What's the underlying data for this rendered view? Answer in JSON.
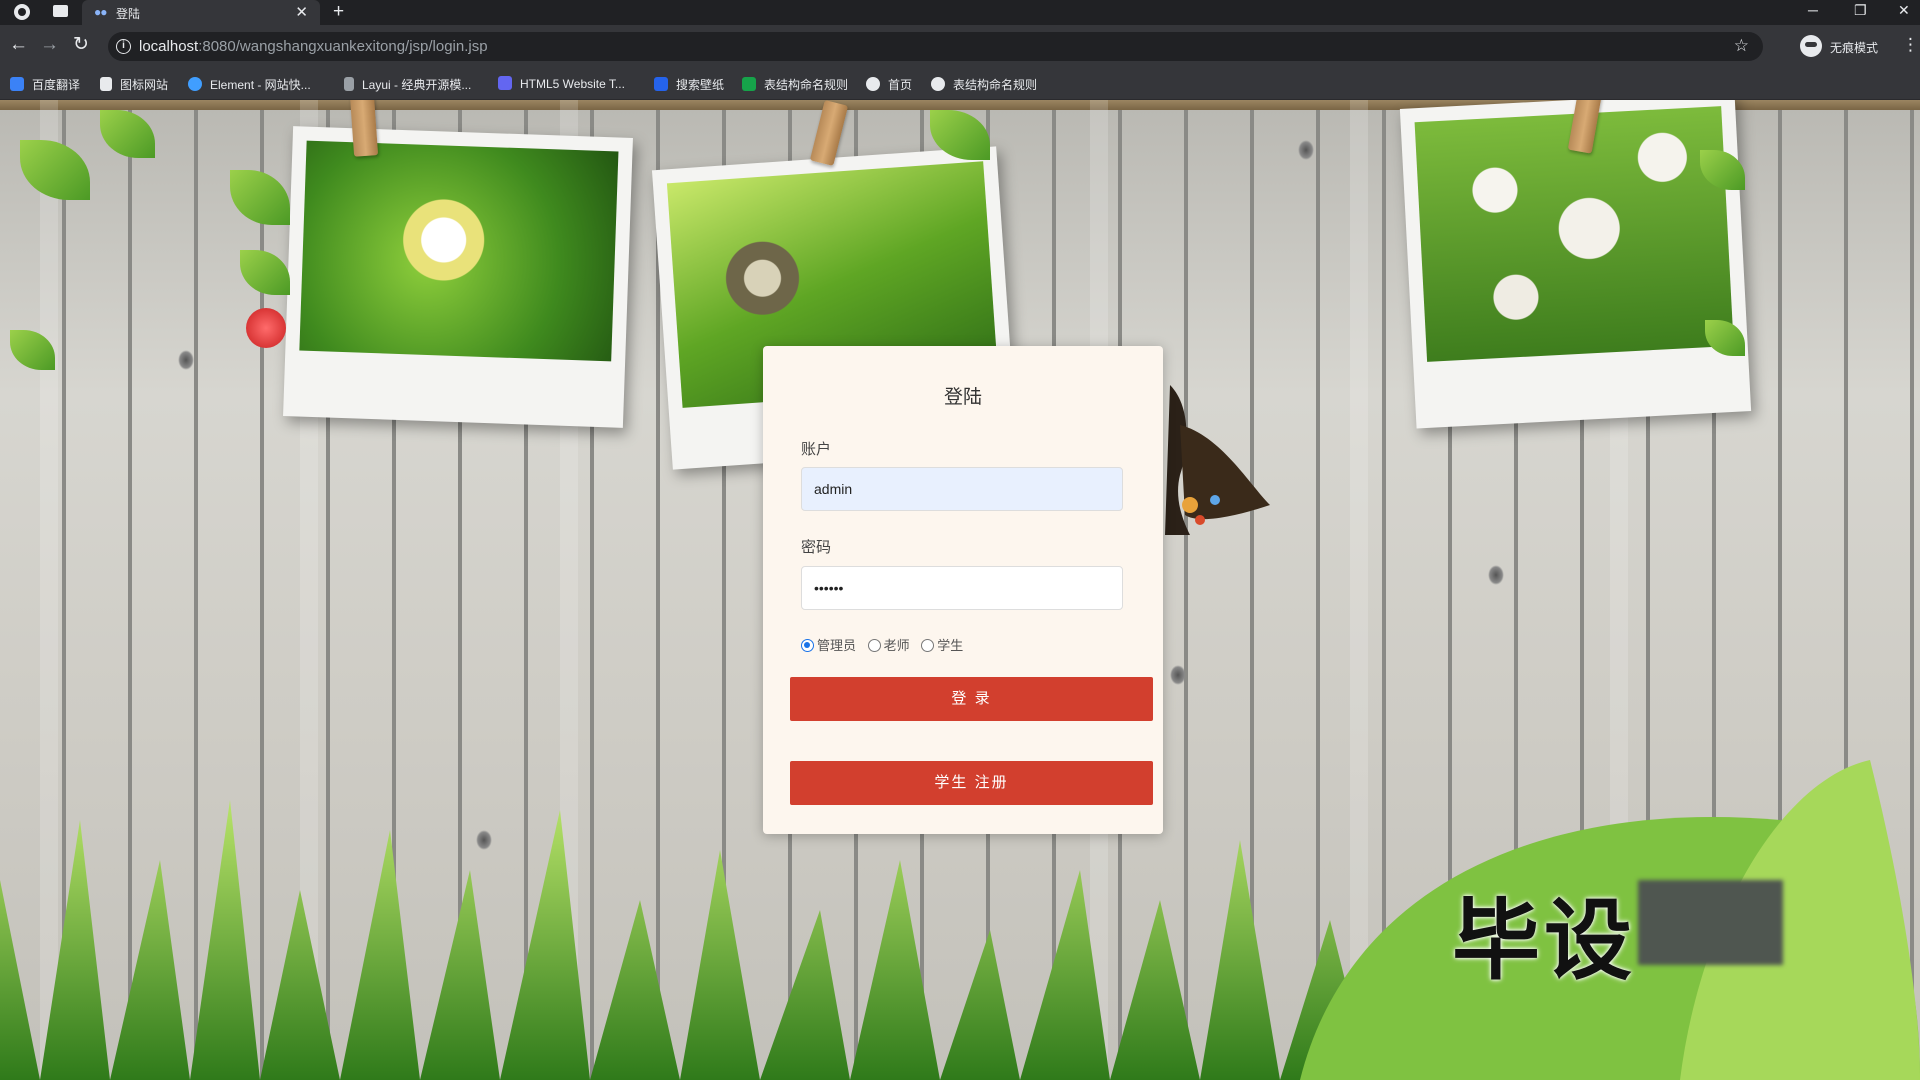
{
  "browser": {
    "tab_title": "登陆",
    "url_host": "localhost",
    "url_path": ":8080/wangshangxuankexitong/jsp/login.jsp",
    "profile_label": "无痕模式",
    "bookmarks": [
      {
        "label": "百度翻译",
        "color": "#3b82f6"
      },
      {
        "label": "图标网站",
        "color": "#e8eaed"
      },
      {
        "label": "Element - 网站快...",
        "color": "#409eff"
      },
      {
        "label": "Layui - 经典开源模...",
        "color": "#1e9fff"
      },
      {
        "label": "HTML5 Website T...",
        "color": "#6366f1"
      },
      {
        "label": "搜索壁纸",
        "color": "#2563eb"
      },
      {
        "label": "表结构命名规则",
        "color": "#16a34a"
      },
      {
        "label": "首页",
        "color": "#e8eaed"
      },
      {
        "label": "表结构命名规则",
        "color": "#e8eaed"
      }
    ]
  },
  "login": {
    "title": "登陆",
    "account_label": "账户",
    "account_value": "admin",
    "password_label": "密码",
    "password_value": "••••••",
    "roles": [
      {
        "label": "管理员",
        "checked": true
      },
      {
        "label": "老师",
        "checked": false
      },
      {
        "label": "学生",
        "checked": false
      }
    ],
    "login_button": "登 录",
    "register_button": "学生 注册"
  },
  "watermark": "毕设",
  "colors": {
    "button": "#d23f2e",
    "card_bg": "#fdf6ee",
    "chrome_bg": "#35363a"
  }
}
